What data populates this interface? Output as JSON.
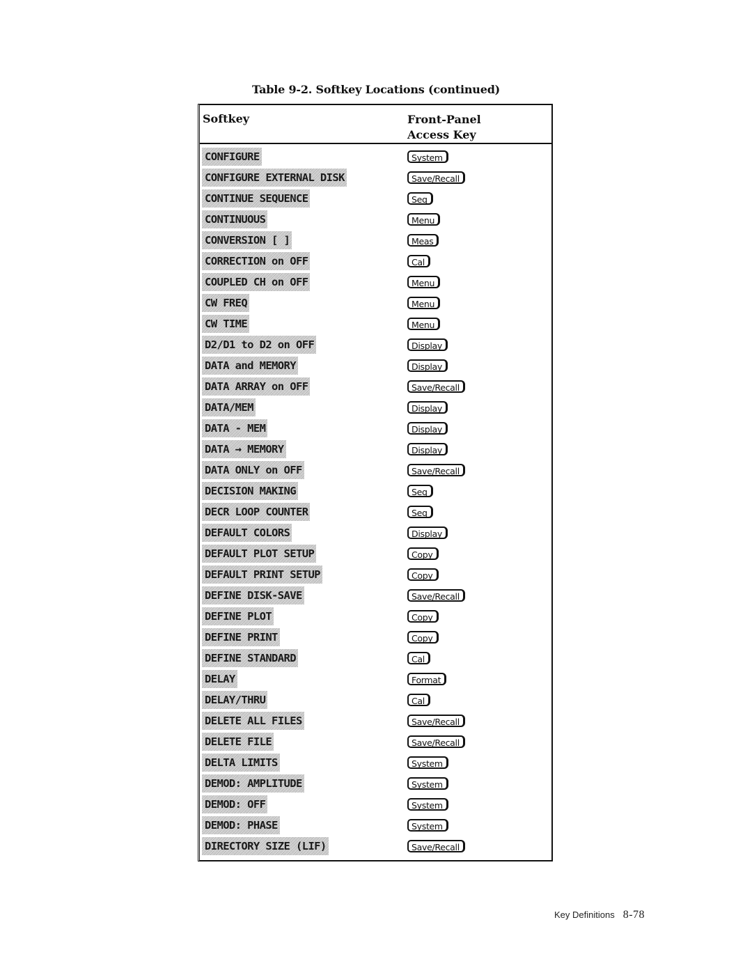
{
  "caption": "Table 9-2. Softkey Locations (continued)",
  "table": {
    "headers": {
      "softkey": "Softkey",
      "access_line1": "Front-Panel",
      "access_line2": "Access Key"
    },
    "rows": [
      {
        "softkey": "CONFIGURE",
        "access_key": "System"
      },
      {
        "softkey": "CONFIGURE EXTERNAL DISK",
        "access_key": "Save/Recall"
      },
      {
        "softkey": "CONTINUE SEQUENCE",
        "access_key": "Seq"
      },
      {
        "softkey": "CONTINUOUS",
        "access_key": "Menu"
      },
      {
        "softkey": "CONVERSION [ ]",
        "access_key": "Meas"
      },
      {
        "softkey": "CORRECTION on OFF",
        "access_key": "Cal"
      },
      {
        "softkey": "COUPLED CH on OFF",
        "access_key": "Menu"
      },
      {
        "softkey": "CW FREQ",
        "access_key": "Menu"
      },
      {
        "softkey": "CW TIME",
        "access_key": "Menu"
      },
      {
        "softkey": "D2/D1 to D2 on OFF",
        "access_key": "Display"
      },
      {
        "softkey": "DATA and MEMORY",
        "access_key": "Display"
      },
      {
        "softkey": "DATA ARRAY on OFF",
        "access_key": "Save/Recall"
      },
      {
        "softkey": "DATA/MEM",
        "access_key": "Display"
      },
      {
        "softkey": "DATA - MEM",
        "access_key": "Display"
      },
      {
        "softkey": "DATA → MEMORY",
        "access_key": "Display"
      },
      {
        "softkey": "DATA ONLY on OFF",
        "access_key": "Save/Recall"
      },
      {
        "softkey": "DECISION MAKING",
        "access_key": "Seq"
      },
      {
        "softkey": "DECR LOOP COUNTER",
        "access_key": "Seq"
      },
      {
        "softkey": "DEFAULT COLORS",
        "access_key": "Display"
      },
      {
        "softkey": "DEFAULT PLOT SETUP",
        "access_key": "Copy"
      },
      {
        "softkey": "DEFAULT PRINT SETUP",
        "access_key": "Copy"
      },
      {
        "softkey": "DEFINE DISK-SAVE",
        "access_key": "Save/Recall"
      },
      {
        "softkey": "DEFINE PLOT",
        "access_key": "Copy"
      },
      {
        "softkey": "DEFINE PRINT",
        "access_key": "Copy"
      },
      {
        "softkey": "DEFINE STANDARD",
        "access_key": "Cal"
      },
      {
        "softkey": "DELAY",
        "access_key": "Format"
      },
      {
        "softkey": "DELAY/THRU",
        "access_key": "Cal"
      },
      {
        "softkey": "DELETE ALL FILES",
        "access_key": "Save/Recall"
      },
      {
        "softkey": "DELETE FILE",
        "access_key": "Save/Recall"
      },
      {
        "softkey": "DELTA LIMITS",
        "access_key": "System"
      },
      {
        "softkey": "DEMOD: AMPLITUDE",
        "access_key": "System"
      },
      {
        "softkey": "DEMOD: OFF",
        "access_key": "System"
      },
      {
        "softkey": "DEMOD: PHASE",
        "access_key": "System"
      },
      {
        "softkey": "DIRECTORY SIZE (LIF)",
        "access_key": "Save/Recall"
      }
    ]
  },
  "footer": {
    "section": "Key Definitions",
    "page": "8-78"
  }
}
